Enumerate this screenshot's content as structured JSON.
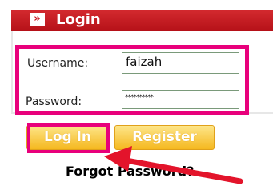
{
  "header": {
    "icon": "double-chevron-right-icon",
    "icon_glyph": "»",
    "title": "Login"
  },
  "form": {
    "username_label": "Username:",
    "username_value": "faizah",
    "password_label": "Password:",
    "password_value": "**********"
  },
  "buttons": {
    "login_label": "Log In",
    "register_label": "Register"
  },
  "links": {
    "forgot_password": "Forgot Password?"
  },
  "colors": {
    "header_red": "#c8161e",
    "highlight_magenta": "#e8007b",
    "button_gold": "#f5b81f",
    "arrow_red": "#e3142b"
  },
  "annotations": {
    "arrow": "red-arrow-pointing-to-login-button"
  }
}
